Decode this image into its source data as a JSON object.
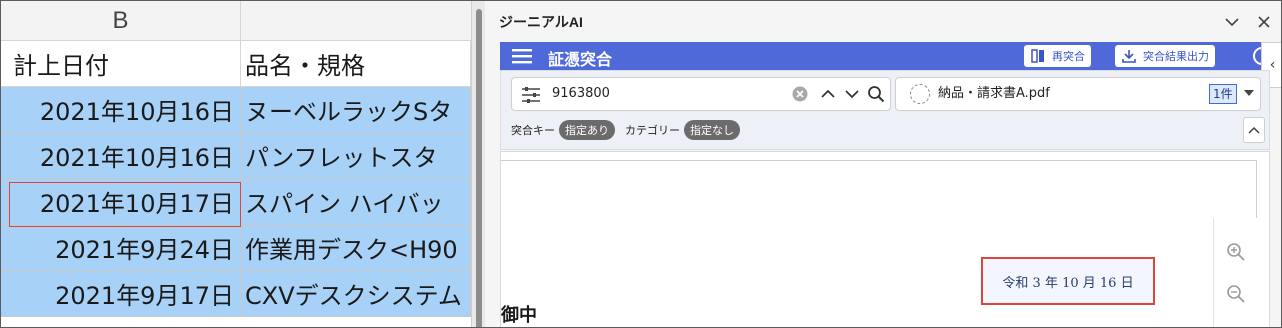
{
  "spreadsheet": {
    "column_letter": "B",
    "headers": {
      "date": "計上日付",
      "name": "品名・規格"
    },
    "rows": [
      {
        "date": "2021年10月16日",
        "name": "ヌーベルラックSタ"
      },
      {
        "date": "2021年10月16日",
        "name": "パンフレットスタ"
      },
      {
        "date": "2021年10月17日",
        "name": "スパイン ハイバッ"
      },
      {
        "date": "2021年9月24日",
        "name": "作業用デスク<H90"
      },
      {
        "date": "2021年9月17日",
        "name": "CXVデスクシステム"
      }
    ]
  },
  "panel": {
    "title": "ジーニアルAI",
    "appbar": {
      "title": "証憑突合",
      "recheck_label": "再突合",
      "export_label": "突合結果出力",
      "color": "#4f6ad8"
    },
    "search": {
      "value": "9163800",
      "document_name": "納品・請求書A.pdf",
      "count_label": "1件"
    },
    "filters": {
      "key_label": "突合キー",
      "key_chip": "指定あり",
      "category_label": "カテゴリー",
      "category_chip": "指定なし"
    },
    "document": {
      "highlighted_date": "令和 3 年 10 月 16 日",
      "heading": "御中"
    }
  },
  "colors": {
    "selection": "#a7d1f7",
    "highlight_border": "#e0453a"
  }
}
